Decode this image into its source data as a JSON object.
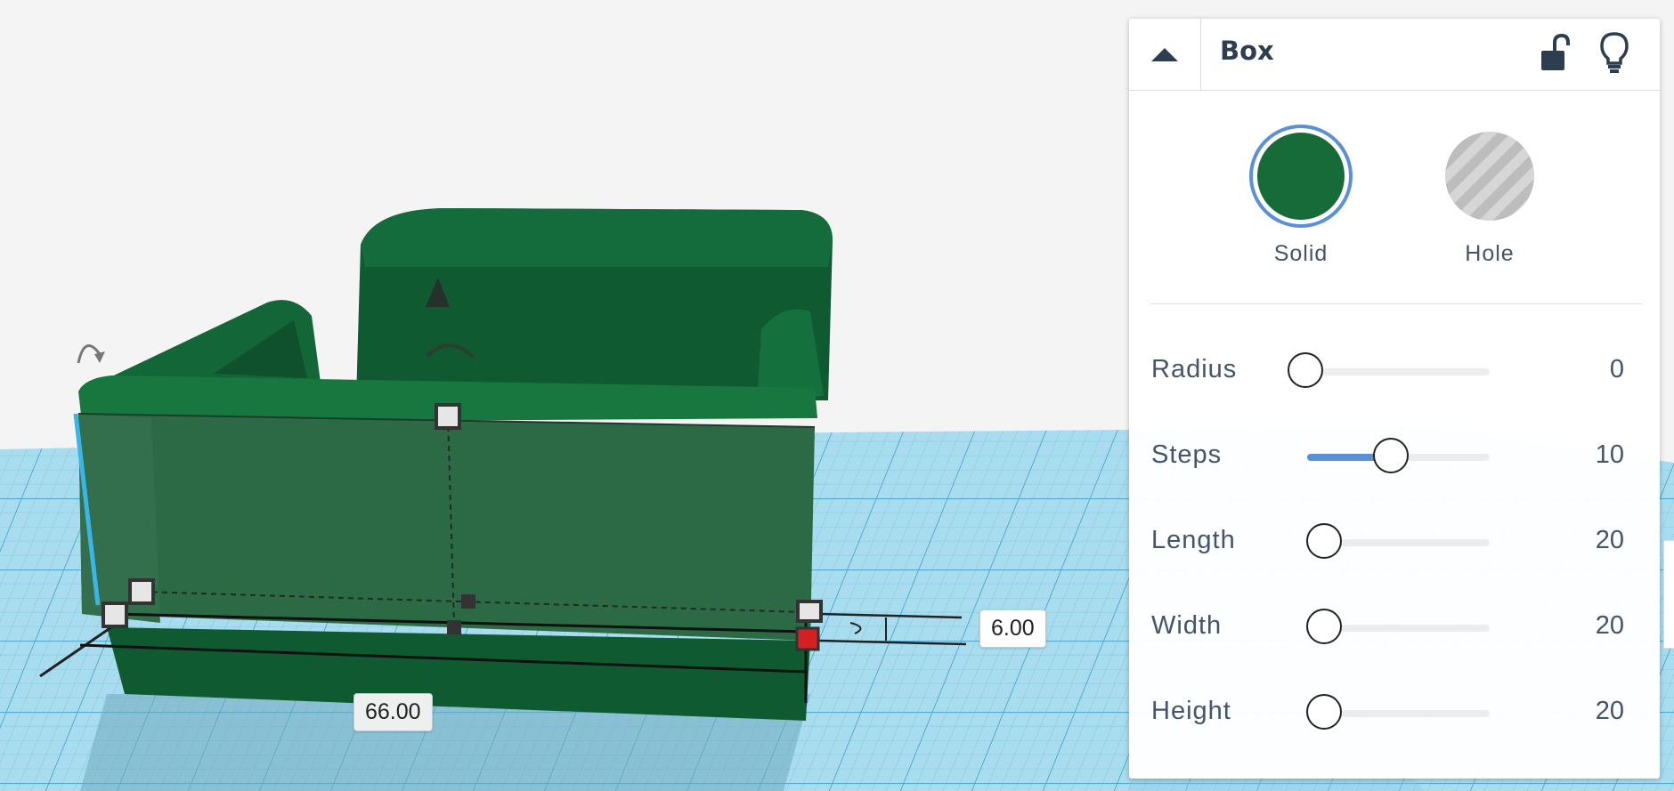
{
  "viewport": {
    "dimension_width": "66.00",
    "dimension_height": "6.00",
    "object_color": "#13663a",
    "grid_color": "#9fd8ec"
  },
  "inspector": {
    "shape_name": "Box",
    "collapse_icon": "caret-up-icon",
    "lock_icon": "unlock-icon",
    "bulb_icon": "lightbulb-icon",
    "types": [
      {
        "label": "Solid",
        "color": "#166b38",
        "selected": true
      },
      {
        "label": "Hole",
        "color": "#bdbdbd",
        "selected": false
      }
    ],
    "properties": [
      {
        "label": "Radius",
        "value": "0",
        "level": 0.0
      },
      {
        "label": "Steps",
        "value": "10",
        "level": 0.47
      },
      {
        "label": "Length",
        "value": "20",
        "level": 0.1
      },
      {
        "label": "Width",
        "value": "20",
        "level": 0.1
      },
      {
        "label": "Height",
        "value": "20",
        "level": 0.1
      }
    ]
  }
}
